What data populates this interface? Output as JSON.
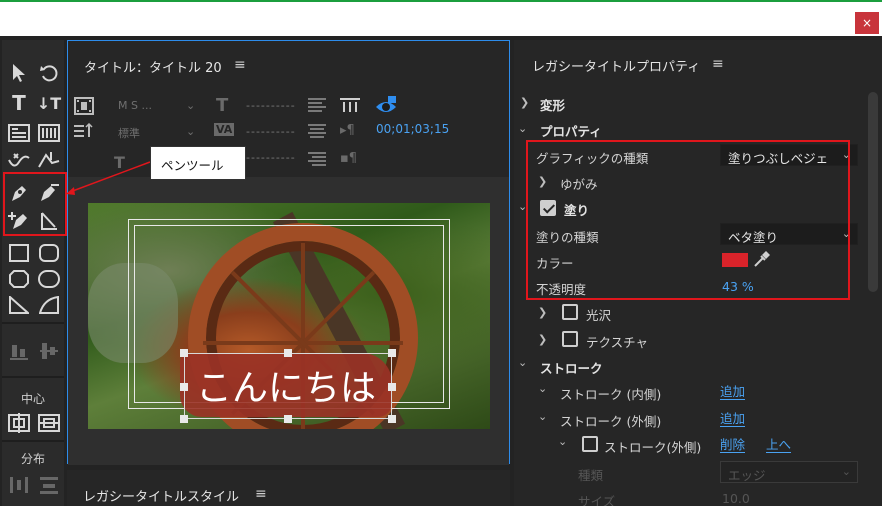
{
  "window": {
    "close_label": "×"
  },
  "tools": {
    "text_tool_1": "T",
    "text_tool_2": "↓T",
    "center_label": "中心",
    "distribute_label": "分布"
  },
  "callout": {
    "text": "ペンツール"
  },
  "title_panel": {
    "title": "タイトル：タイトル 20",
    "menu": "≡",
    "font_family": "M S ...",
    "font_style": "標準",
    "dashes": "----------",
    "timecode": "00;01;03;15"
  },
  "canvas": {
    "title_text": "こんにちは"
  },
  "style_panel": {
    "title": "レガシータイトルスタイル",
    "menu": "≡"
  },
  "properties": {
    "title": "レガシータイトルプロパティ",
    "menu": "≡",
    "transform_label": "変形",
    "properties_label": "プロパティ",
    "graphic_type_label": "グラフィックの種類",
    "graphic_type_value": "塗りつぶしベジェ",
    "distort_label": "ゆがみ",
    "fill_label": "塗り",
    "fill_type_label": "塗りの種類",
    "fill_type_value": "ベタ塗り",
    "color_label": "カラー",
    "color_value": "#d9232a",
    "opacity_label": "不透明度",
    "opacity_value": "43 %",
    "sheen_label": "光沢",
    "texture_label": "テクスチャ",
    "stroke_label": "ストローク",
    "inner_stroke_label": "ストローク (内側)",
    "inner_stroke_action": "追加",
    "outer_stroke_label": "ストローク (外側)",
    "outer_stroke_action": "追加",
    "outer_stroke_item": "ストローク(外側)",
    "delete_action": "削除",
    "up_action": "上へ",
    "type_label": "種類",
    "type_value": "エッジ",
    "size_label": "サイズ",
    "size_value": "10.0"
  },
  "colors": {
    "accent": "#4aa2f2",
    "highlight": "#e0161c",
    "swatch": "#d9232a"
  }
}
